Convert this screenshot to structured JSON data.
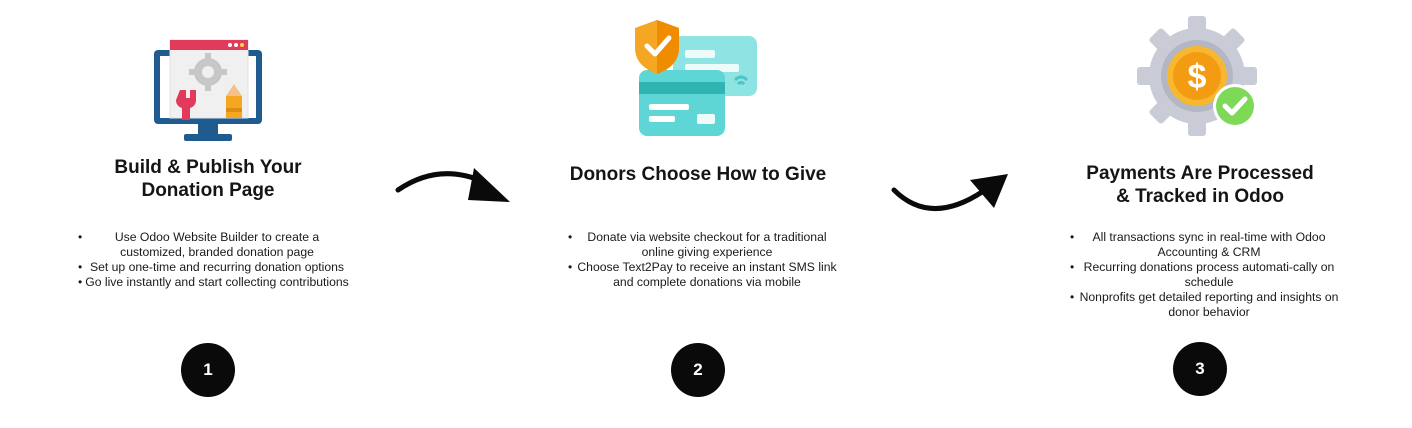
{
  "steps": [
    {
      "title": "Build & Publish Your\nDonation Page",
      "bullets": [
        "Use Odoo Website Builder to create a customized, branded donation page",
        "Set up one-time and recurring donation options",
        "Go live instantly and start collecting contributions"
      ],
      "number": "1",
      "icon": "website-builder-icon"
    },
    {
      "title": "Donors Choose How to Give",
      "bullets": [
        "Donate via website checkout for a traditional online giving experience",
        "Choose Text2Pay to receive an instant SMS link and complete donations via mobile"
      ],
      "number": "2",
      "icon": "credit-card-shield-icon"
    },
    {
      "title": "Payments Are Processed\n& Tracked in Odoo",
      "bullets": [
        "All transactions sync in real-time with Odoo Accounting & CRM",
        "Recurring donations process automati-cally on schedule",
        "Nonprofits get detailed reporting and insights on donor behavior"
      ],
      "number": "3",
      "icon": "gear-coin-check-icon"
    }
  ],
  "colors": {
    "circle": "#0a0a0a",
    "monitor_blue": "#1f5b8e",
    "card_teal": "#5fd6d6",
    "shield_orange": "#f5a623",
    "coin_gold": "#f7b731",
    "gear_grey": "#c9ccd6",
    "check_green": "#7ed957"
  }
}
